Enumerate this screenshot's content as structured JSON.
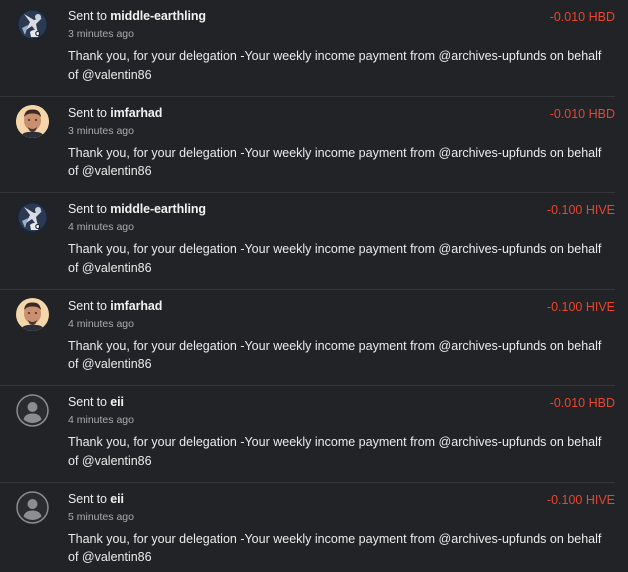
{
  "transfers": [
    {
      "avatar_icon": "community-logo-icon",
      "prefix": "Sent to",
      "recipient": "middle-earthling",
      "time": "3 minutes ago",
      "amount": "-0.010 HBD",
      "memo": "Thank you, for your delegation -Your weekly income payment from @archives-upfunds on behalf of @valentin86"
    },
    {
      "avatar_icon": "user-photo-icon",
      "prefix": "Sent to",
      "recipient": "imfarhad",
      "time": "3 minutes ago",
      "amount": "-0.010 HBD",
      "memo": "Thank you, for your delegation -Your weekly income payment from @archives-upfunds on behalf of @valentin86"
    },
    {
      "avatar_icon": "community-logo-icon",
      "prefix": "Sent to",
      "recipient": "middle-earthling",
      "time": "4 minutes ago",
      "amount": "-0.100 HIVE",
      "memo": "Thank you, for your delegation -Your weekly income payment from @archives-upfunds on behalf of @valentin86"
    },
    {
      "avatar_icon": "user-photo-icon",
      "prefix": "Sent to",
      "recipient": "imfarhad",
      "time": "4 minutes ago",
      "amount": "-0.100 HIVE",
      "memo": "Thank you, for your delegation -Your weekly income payment from @archives-upfunds on behalf of @valentin86"
    },
    {
      "avatar_icon": "default-user-icon",
      "prefix": "Sent to",
      "recipient": "eii",
      "time": "4 minutes ago",
      "amount": "-0.010 HBD",
      "memo": "Thank you, for your delegation -Your weekly income payment from @archives-upfunds on behalf of @valentin86"
    },
    {
      "avatar_icon": "default-user-icon",
      "prefix": "Sent to",
      "recipient": "eii",
      "time": "5 minutes ago",
      "amount": "-0.100 HIVE",
      "memo": "Thank you, for your delegation -Your weekly income payment from @archives-upfunds on behalf of @valentin86"
    }
  ],
  "colors": {
    "background": "#222326",
    "divider": "#35373b",
    "amount_negative": "#e8462f",
    "text_primary": "#ececec",
    "text_muted": "#a9abaf"
  }
}
